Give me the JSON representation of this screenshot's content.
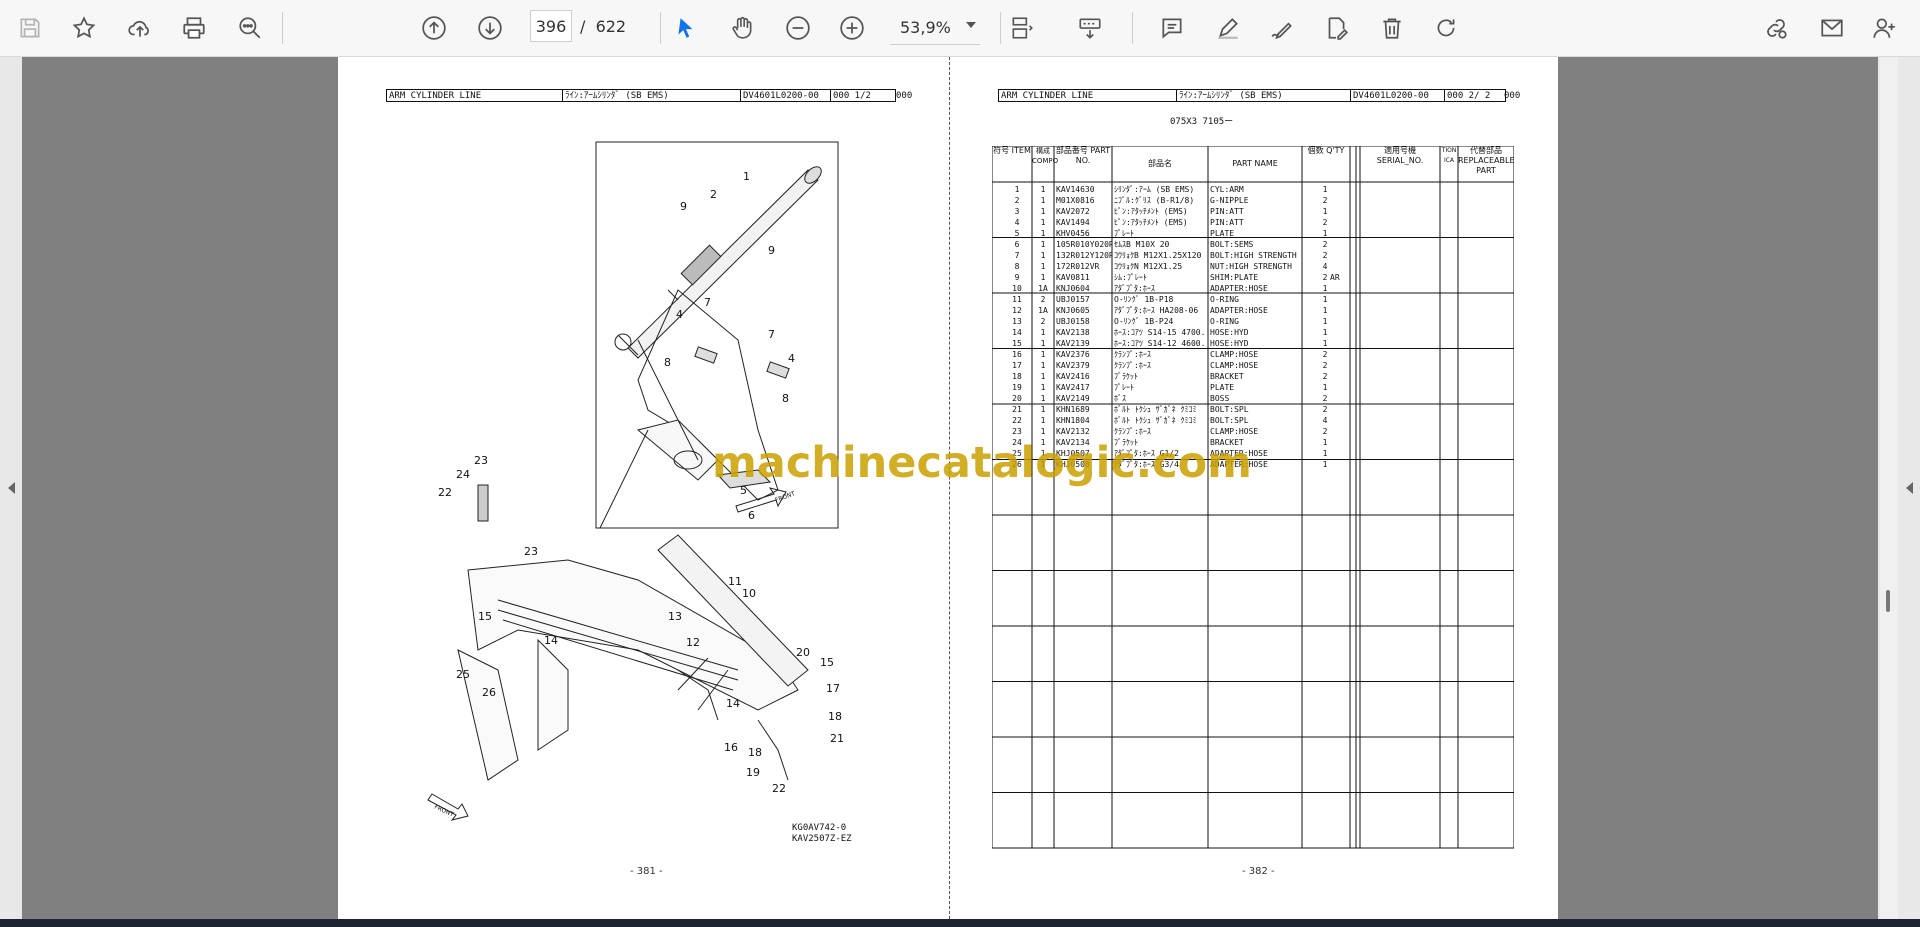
{
  "toolbar": {
    "page_current": "396",
    "page_separator": "/",
    "page_total": "622",
    "zoom": "53,9%"
  },
  "left_page": {
    "header": [
      "ARM CYLINDER LINE",
      "ﾗｲﾝ:ｱｰﾑｼﾘﾝﾀﾞ (SB EMS)",
      "DV4601L0200-00",
      "000  1/2"
    ],
    "header_tail": "000",
    "drawing_labels": [
      "1",
      "2",
      "9",
      "9",
      "7",
      "7",
      "4",
      "4",
      "8",
      "8",
      "5",
      "6",
      "23",
      "24",
      "22",
      "23",
      "11",
      "10",
      "13",
      "12",
      "15",
      "14",
      "20",
      "15",
      "17",
      "25",
      "26",
      "14",
      "18",
      "16",
      "18",
      "21",
      "19",
      "22"
    ],
    "front_label": "FRONT",
    "codes": [
      "KG0AV742-0",
      "KAV2507Z-EZ"
    ],
    "page_number": "- 381 -"
  },
  "right_page": {
    "header": [
      "ARM CYLINDER LINE",
      "ﾗｲﾝ:ｱｰﾑｼﾘﾝﾀﾞ (SB EMS)",
      "DV4601L0200-00",
      "000  2/ 2"
    ],
    "header_tail": "000",
    "sub_code": "075X3 7105ー",
    "columns": [
      "符号 ITEM",
      "構成 COMPO",
      "部品番号 PART NO.",
      "部品名",
      "PART  NAME",
      "個数 Q'TY",
      "",
      "適用号機 SERIAL_NO.",
      "TION ICA",
      "代替部品 REPLACEABLE PART"
    ],
    "rows": [
      [
        "1",
        "1",
        "KAV14630",
        "ｼﾘﾝﾀﾞ:ｱｰﾑ (SB EMS)",
        "CYL:ARM",
        "1",
        ""
      ],
      [
        "2",
        "1",
        "M01X0816",
        "ﾆﾌﾟﾙ:ｸﾞﾘｽ (B-R1/8)",
        "G-NIPPLE",
        "2",
        ""
      ],
      [
        "3",
        "1",
        "KAV2072",
        "ﾋﾟﾝ:ｱﾀｯﾁﾒﾝﾄ (EMS)",
        "PIN:ATT",
        "1",
        ""
      ],
      [
        "4",
        "1",
        "KAV1494",
        "ﾋﾟﾝ:ｱﾀｯﾁﾒﾝﾄ (EMS)",
        "PIN:ATT",
        "2",
        ""
      ],
      [
        "5",
        "1",
        "KHV0456",
        "ﾌﾟﾚｰﾄ",
        "PLATE",
        "1",
        ""
      ],
      [
        "6",
        "1",
        "105R010Y020R",
        "ｾﾑｽB M10X 20",
        "BOLT:SEMS",
        "2",
        ""
      ],
      [
        "7",
        "1",
        "132R012Y120R",
        "ｺｳﾘｮｸB M12X1.25X120",
        "BOLT:HIGH STRENGTH",
        "2",
        ""
      ],
      [
        "8",
        "1",
        "172R012VR",
        "ｺｳﾘｮｸN M12X1.25",
        "NUT:HIGH STRENGTH",
        "4",
        ""
      ],
      [
        "9",
        "1",
        "KAV0811",
        "ｼﾑ:ﾌﾟﾚｰﾄ",
        "SHIM:PLATE",
        "2",
        "AR"
      ],
      [
        "10",
        "1A",
        "KNJ0604",
        "ｱﾀﾞﾌﾟﾀ:ﾎｰｽ",
        "ADAPTER:HOSE",
        "1",
        ""
      ],
      [
        "11",
        "2",
        "UBJ0157",
        "O-ﾘﾝｸﾞ 1B-P18",
        "O-RING",
        "1",
        ""
      ],
      [
        "12",
        "1A",
        "KNJ0605",
        "ｱﾀﾞﾌﾟﾀ:ﾎｰｽ HA208-06",
        "ADAPTER:HOSE",
        "1",
        ""
      ],
      [
        "13",
        "2",
        "UBJ0158",
        "O-ﾘﾝｸﾞ 1B-P24",
        "O-RING",
        "1",
        ""
      ],
      [
        "14",
        "1",
        "KAV2138",
        "ﾎｰｽ:ｺｱﾂ S14-15 4700.",
        "HOSE:HYD",
        "1",
        ""
      ],
      [
        "15",
        "1",
        "KAV2139",
        "ﾎｰｽ:ｺｱﾂ S14-12 4600.",
        "HOSE:HYD",
        "1",
        ""
      ],
      [
        "16",
        "1",
        "KAV2376",
        "ｸﾗﾝﾌﾟ:ﾎｰｽ",
        "CLAMP:HOSE",
        "2",
        ""
      ],
      [
        "17",
        "1",
        "KAV2379",
        "ｸﾗﾝﾌﾟ:ﾎｰｽ",
        "CLAMP:HOSE",
        "2",
        ""
      ],
      [
        "18",
        "1",
        "KAV2416",
        "ﾌﾞﾗｹｯﾄ",
        "BRACKET",
        "2",
        ""
      ],
      [
        "19",
        "1",
        "KAV2417",
        "ﾌﾟﾚｰﾄ",
        "PLATE",
        "1",
        ""
      ],
      [
        "20",
        "1",
        "KAV2149",
        "ﾎﾞｽ",
        "BOSS",
        "2",
        ""
      ],
      [
        "21",
        "1",
        "KHN1689",
        "ﾎﾞﾙﾄ ﾄｸｼｭ ｻﾞｶﾞﾈ ｸﾐｺﾐ",
        "BOLT:SPL",
        "2",
        ""
      ],
      [
        "22",
        "1",
        "KHN1804",
        "ﾎﾞﾙﾄ ﾄｸｼｭ ｻﾞｶﾞﾈ ｸﾐｺﾐ",
        "BOLT:SPL",
        "4",
        ""
      ],
      [
        "23",
        "1",
        "KAV2132",
        "ｸﾗﾝﾌﾟ:ﾎｰｽ",
        "CLAMP:HOSE",
        "2",
        ""
      ],
      [
        "24",
        "1",
        "KAV2134",
        "ﾌﾞﾗｹｯﾄ",
        "BRACKET",
        "1",
        ""
      ],
      [
        "25",
        "1",
        "KHJ0507",
        "ｱﾀﾞﾌﾟﾀ:ﾎｰｽ G1/2",
        "ADAPTER:HOSE",
        "1",
        ""
      ],
      [
        "26",
        "1",
        "KHJ0508",
        "ｱﾀﾞﾌﾟﾀ:ﾎｰｽ G3/4",
        "ADAPTER:HOSE",
        "1",
        ""
      ]
    ],
    "page_number": "- 382 -"
  },
  "watermark": "machinecatalogic.com"
}
